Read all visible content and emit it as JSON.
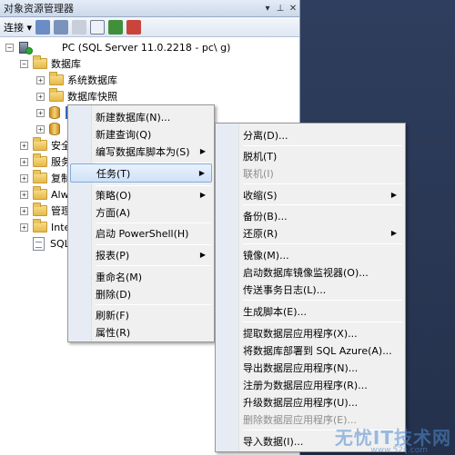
{
  "panel": {
    "title": "对象资源管理器",
    "pin_glyph": "▾",
    "pin2_glyph": "⊥",
    "close_glyph": "✕"
  },
  "toolbar": {
    "connect_label": "连接",
    "connect_arrow": "▾"
  },
  "tree": {
    "server_label": "PC (SQL Server 11.0.2218 - pc\\ g)",
    "databases": "数据库",
    "system_db": "系统数据库",
    "db_snapshots": "数据库快照",
    "security": "安全",
    "server_objects": "服务",
    "replication": "复制",
    "alwayson": "Alw",
    "management": "管理",
    "integration": "Inte",
    "sql_agent": "SQL",
    "expand_plus": "+",
    "expand_minus": "−"
  },
  "context_menu": {
    "items": [
      {
        "label": "新建数据库(N)..."
      },
      {
        "label": "新建查询(Q)"
      },
      {
        "label": "编写数据库脚本为(S)"
      },
      {
        "label": "任务(T)"
      },
      {
        "label": "策略(O)"
      },
      {
        "label": "方面(A)"
      },
      {
        "label": "启动 PowerShell(H)"
      },
      {
        "label": "报表(P)"
      },
      {
        "label": "重命名(M)"
      },
      {
        "label": "删除(D)"
      },
      {
        "label": "刷新(F)"
      },
      {
        "label": "属性(R)"
      }
    ]
  },
  "tasks_menu": {
    "items": [
      {
        "label": "分离(D)..."
      },
      {
        "label": "脱机(T)"
      },
      {
        "label": "联机(I)"
      },
      {
        "label": "收缩(S)"
      },
      {
        "label": "备份(B)..."
      },
      {
        "label": "还原(R)"
      },
      {
        "label": "镜像(M)..."
      },
      {
        "label": "启动数据库镜像监视器(O)..."
      },
      {
        "label": "传送事务日志(L)..."
      },
      {
        "label": "生成脚本(E)..."
      },
      {
        "label": "提取数据层应用程序(X)..."
      },
      {
        "label": "将数据库部署到 SQL Azure(A)..."
      },
      {
        "label": "导出数据层应用程序(N)..."
      },
      {
        "label": "注册为数据层应用程序(R)..."
      },
      {
        "label": "升级数据层应用程序(U)..."
      },
      {
        "label": "删除数据层应用程序(E)..."
      },
      {
        "label": "导入数据(I)..."
      }
    ]
  },
  "submenu_arrow": "▶",
  "watermark": {
    "text": "无忧IT技术网",
    "url": "www.52ij.com"
  }
}
